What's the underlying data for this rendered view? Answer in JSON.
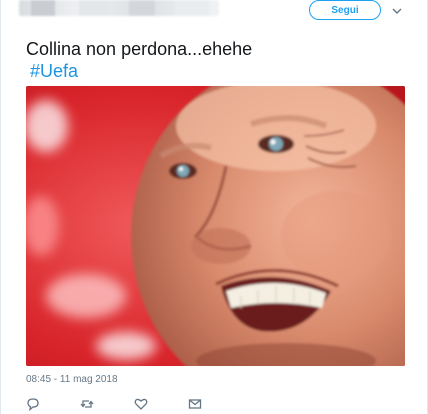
{
  "header": {
    "follow_label": "Segui",
    "caret_icon": "chevron-down-icon"
  },
  "tweet": {
    "text": "Collina non perdona...ehehe",
    "hashtag": "#Uefa",
    "timestamp": "08:45 - 11 mag 2018"
  },
  "actions": {
    "reply_icon": "reply-icon",
    "retweet_icon": "retweet-icon",
    "like_icon": "heart-icon",
    "message_icon": "envelope-icon"
  },
  "colors": {
    "accent": "#1da1f2",
    "hashtag": "#1b95e0",
    "text": "#14171a",
    "muted": "#657786",
    "image_background": "#d8242a"
  }
}
